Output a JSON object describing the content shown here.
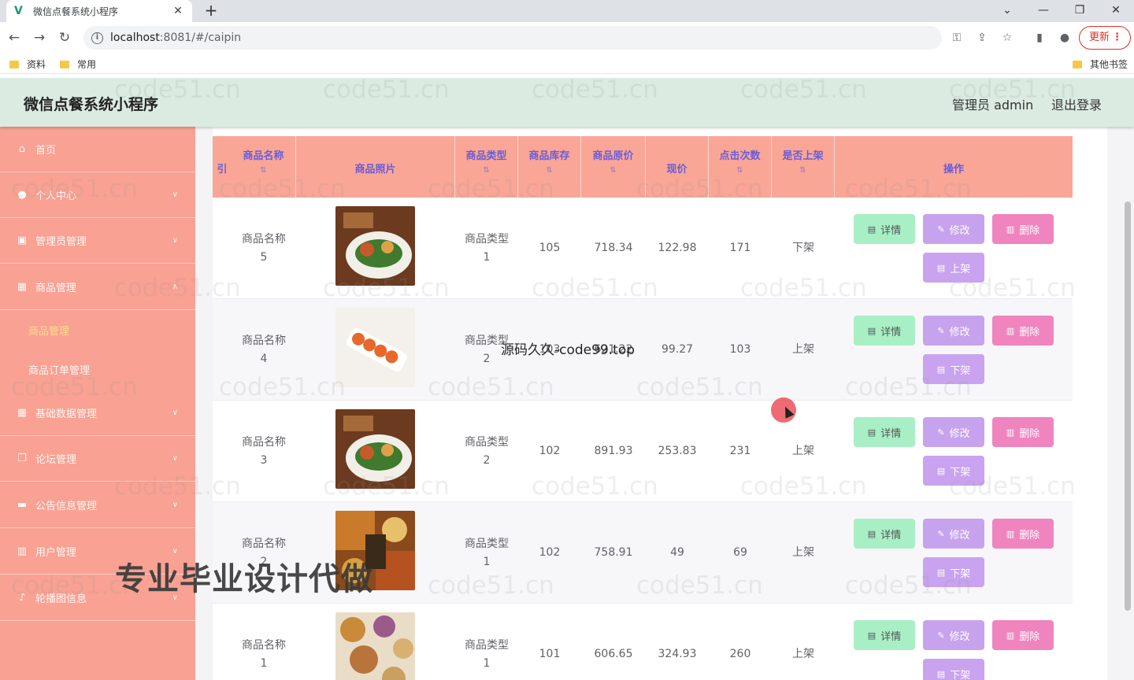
{
  "browser": {
    "tab_title": "微信点餐系统小程序",
    "url_host": "localhost",
    "url_path": ":8081/#/caipin",
    "update_label": "更新",
    "bookmarks": [
      "资料",
      "常用"
    ],
    "other_bookmarks": "其他书签"
  },
  "header": {
    "title": "微信点餐系统小程序",
    "admin_text": "管理员 admin",
    "logout": "退出登录"
  },
  "sidebar": {
    "items": [
      {
        "label": "首页",
        "icon": "home-icon"
      },
      {
        "label": "个人中心",
        "icon": "user-icon"
      },
      {
        "label": "管理员管理",
        "icon": "image-icon"
      },
      {
        "label": "商品管理",
        "icon": "grid-icon"
      },
      {
        "label": "基础数据管理",
        "icon": "grid-icon"
      },
      {
        "label": "论坛管理",
        "icon": "copy-icon"
      },
      {
        "label": "公告信息管理",
        "icon": "chat-icon"
      },
      {
        "label": "用户管理",
        "icon": "book-icon"
      },
      {
        "label": "轮播图信息",
        "icon": "mic-icon"
      }
    ],
    "sub_items": [
      {
        "label": "商品管理",
        "active": true
      },
      {
        "label": "商品订单管理",
        "active": false
      }
    ]
  },
  "table": {
    "columns": {
      "index": "引",
      "name": "商品名称",
      "photo": "商品照片",
      "type": "商品类型",
      "stock": "商品库存",
      "orig_price": "商品原价",
      "price": "现价",
      "clicks": "点击次数",
      "shelf": "是否上架",
      "ops": "操作"
    },
    "buttons": {
      "detail": "详情",
      "edit": "修改",
      "delete": "删除",
      "up": "上架",
      "down": "下架"
    },
    "rows": [
      {
        "name_a": "商品名称",
        "name_b": "5",
        "type_a": "商品类型",
        "type_b": "1",
        "stock": "105",
        "orig_price": "718.34",
        "price": "122.98",
        "clicks": "171",
        "shelf": "下架",
        "action": "上架"
      },
      {
        "name_a": "商品名称",
        "name_b": "4",
        "type_a": "商品类型",
        "type_b": "2",
        "stock": "103",
        "orig_price": "621.22",
        "price": "99.27",
        "clicks": "103",
        "shelf": "上架",
        "action": "下架"
      },
      {
        "name_a": "商品名称",
        "name_b": "3",
        "type_a": "商品类型",
        "type_b": "2",
        "stock": "102",
        "orig_price": "891.93",
        "price": "253.83",
        "clicks": "231",
        "shelf": "上架",
        "action": "下架"
      },
      {
        "name_a": "商品名称",
        "name_b": "2",
        "type_a": "商品类型",
        "type_b": "1",
        "stock": "102",
        "orig_price": "758.91",
        "price": "49",
        "clicks": "69",
        "shelf": "上架",
        "action": "下架"
      },
      {
        "name_a": "商品名称",
        "name_b": "1",
        "type_a": "商品类型",
        "type_b": "1",
        "stock": "101",
        "orig_price": "606.65",
        "price": "324.93",
        "clicks": "260",
        "shelf": "上架",
        "action": "下架"
      }
    ]
  },
  "overlays": {
    "watermark": "code51.cn",
    "promo": "专业毕业设计代做",
    "promo2": "源码久久-code99.top"
  }
}
